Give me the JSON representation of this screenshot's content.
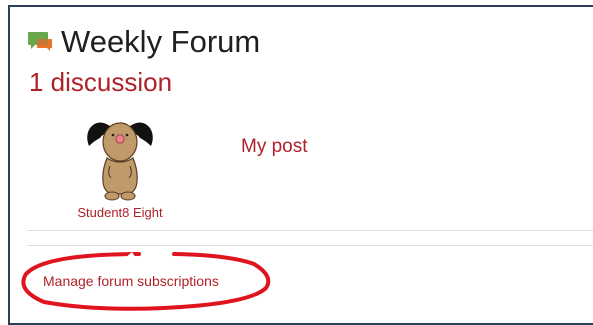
{
  "forum": {
    "title": "Weekly Forum",
    "icon": "forum-chat-icon"
  },
  "discussion_count": "1 discussion",
  "post": {
    "author": "Student8 Eight",
    "avatar": "dog-avatar",
    "title": "My post"
  },
  "manage_link": "Manage forum subscriptions",
  "colors": {
    "link": "#b0222b",
    "title": "#1f1f1f",
    "frame_border": "#2b3f55",
    "highlight": "#e0141e"
  }
}
